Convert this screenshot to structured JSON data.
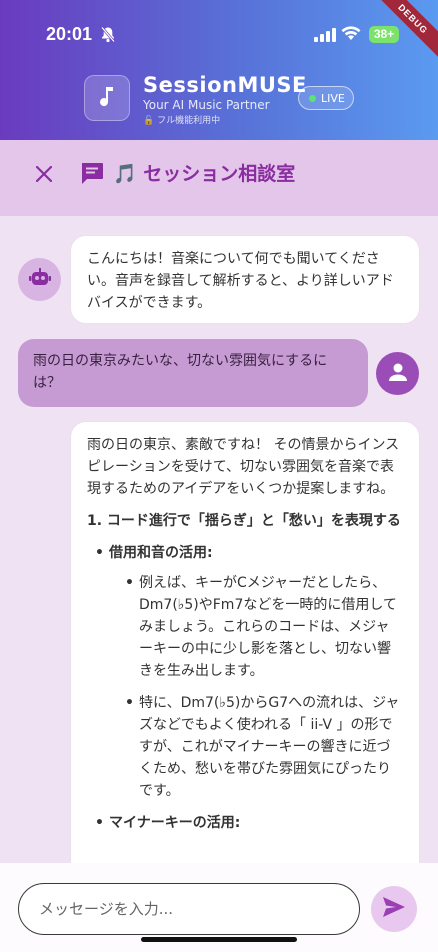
{
  "status_bar": {
    "time": "20:01",
    "battery": "38+",
    "icons": [
      "bell-slash-icon",
      "signal-icon",
      "wifi-icon",
      "battery-icon"
    ]
  },
  "debug_label": "DEBUG",
  "app_header": {
    "app_name": "SessionMUSE",
    "tagline": "Your AI Music Partner",
    "feature_note": "🔓 フル機能利用中",
    "live_label": "LIVE",
    "logo_icon": "music-note-icon"
  },
  "title_bar": {
    "title": "🎵 セッション相談室",
    "close_icon": "close-icon",
    "chat_icon": "chat-bubble-icon"
  },
  "messages": {
    "bot_1": "こんにちは！音楽について何でも聞いてください。音声を録音して解析すると、より詳しいアドバイスができます。",
    "user_1": "雨の日の東京みたいな、切ない雰囲気にするには？",
    "bot_2": {
      "intro": "雨の日の東京、素敵ですね！ その情景からインスピレーションを受けて、切ない雰囲気を音楽で表現するためのアイデアをいくつか提案しますね。",
      "heading": "1. コード進行で「揺らぎ」と「愁い」を表現する",
      "item_1_title": "借用和音の活用:",
      "item_1_sub_1": "例えば、キーがCメジャーだとしたら、Dm7(♭5)やFm7などを一時的に借用してみましょう。これらのコードは、メジャーキーの中に少し影を落とし、切ない響きを生み出します。",
      "item_1_sub_2": "特に、Dm7(♭5)からG7への流れは、ジャズなどでもよく使われる「 ii-V 」の形ですが、これがマイナーキーの響きに近づくため、愁いを帯びた雰囲気にぴったりです。",
      "item_2_title": "マイナーキーの活用:"
    }
  },
  "composer": {
    "placeholder": "メッセージを入力...",
    "send_icon": "send-icon"
  },
  "colors": {
    "accent": "#8a2da0",
    "header_gradient_start": "#6a3bbf",
    "header_gradient_end": "#5a9af0",
    "background": "#efe2f3",
    "user_bubble": "#c69bd4"
  }
}
